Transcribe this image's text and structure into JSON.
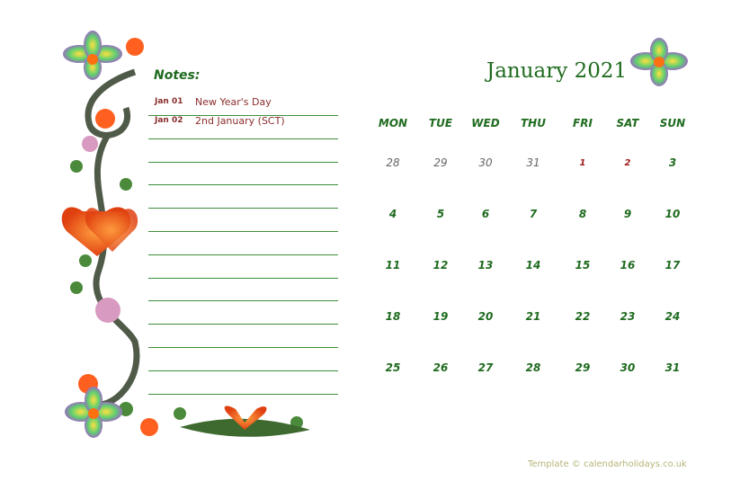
{
  "notes": {
    "title": "Notes:",
    "entries": [
      {
        "date": "Jan 01",
        "text": "New Year's Day"
      },
      {
        "date": "Jan 02",
        "text": "2nd January (SCT)"
      }
    ]
  },
  "calendar": {
    "title": "January 2021",
    "weekdays": [
      "MON",
      "TUE",
      "WED",
      "THU",
      "FRI",
      "SAT",
      "SUN"
    ],
    "weeks": [
      [
        {
          "d": "28",
          "t": "other"
        },
        {
          "d": "29",
          "t": "other"
        },
        {
          "d": "30",
          "t": "other"
        },
        {
          "d": "31",
          "t": "other"
        },
        {
          "d": "1",
          "t": "hol"
        },
        {
          "d": "2",
          "t": "hol"
        },
        {
          "d": "3",
          "t": ""
        }
      ],
      [
        {
          "d": "4",
          "t": ""
        },
        {
          "d": "5",
          "t": ""
        },
        {
          "d": "6",
          "t": ""
        },
        {
          "d": "7",
          "t": ""
        },
        {
          "d": "8",
          "t": ""
        },
        {
          "d": "9",
          "t": ""
        },
        {
          "d": "10",
          "t": ""
        }
      ],
      [
        {
          "d": "11",
          "t": ""
        },
        {
          "d": "12",
          "t": ""
        },
        {
          "d": "13",
          "t": ""
        },
        {
          "d": "14",
          "t": ""
        },
        {
          "d": "15",
          "t": ""
        },
        {
          "d": "16",
          "t": ""
        },
        {
          "d": "17",
          "t": ""
        }
      ],
      [
        {
          "d": "18",
          "t": ""
        },
        {
          "d": "19",
          "t": ""
        },
        {
          "d": "20",
          "t": ""
        },
        {
          "d": "21",
          "t": ""
        },
        {
          "d": "22",
          "t": ""
        },
        {
          "d": "23",
          "t": ""
        },
        {
          "d": "24",
          "t": ""
        }
      ],
      [
        {
          "d": "25",
          "t": ""
        },
        {
          "d": "26",
          "t": ""
        },
        {
          "d": "27",
          "t": ""
        },
        {
          "d": "28",
          "t": ""
        },
        {
          "d": "29",
          "t": ""
        },
        {
          "d": "30",
          "t": ""
        },
        {
          "d": "31",
          "t": ""
        }
      ]
    ]
  },
  "footer": "Template © calendarholidays.co.uk",
  "colors": {
    "accent": "#1f6b1f",
    "holiday": "#a01818",
    "notes_text": "#8b2d2d"
  }
}
